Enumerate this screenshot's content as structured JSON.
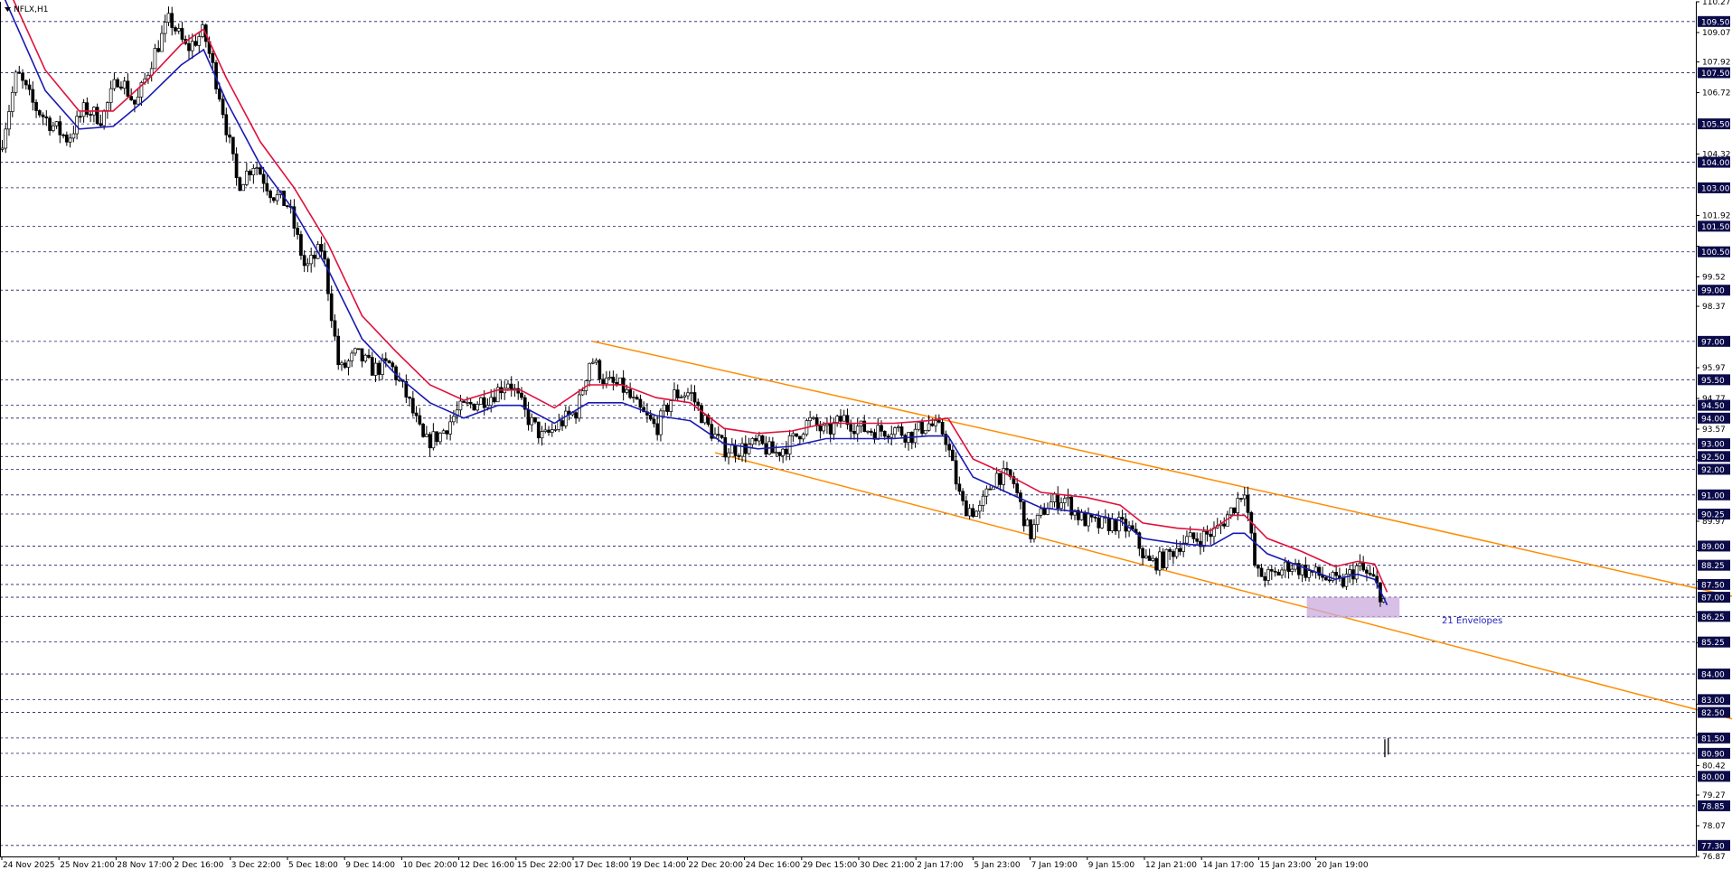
{
  "window": {
    "symbol": "NFLX,H1",
    "menu_icon": "triangle-down-icon"
  },
  "chart_data": {
    "type": "candlestick",
    "symbol": "NFLX",
    "timeframe": "H1",
    "y_range": [
      76.87,
      110.27
    ],
    "x_ticks": [
      "24 Nov 2025",
      "25 Nov 21:00",
      "28 Nov 17:00",
      "2 Dec 16:00",
      "3 Dec 22:00",
      "5 Dec 18:00",
      "9 Dec 14:00",
      "10 Dec 20:00",
      "12 Dec 16:00",
      "15 Dec 22:00",
      "17 Dec 18:00",
      "19 Dec 14:00",
      "22 Dec 20:00",
      "24 Dec 16:00",
      "29 Dec 15:00",
      "30 Dec 21:00",
      "2 Jan 17:00",
      "5 Jan 23:00",
      "7 Jan 19:00",
      "9 Jan 15:00",
      "12 Jan 21:00",
      "14 Jan 17:00",
      "15 Jan 23:00",
      "20 Jan 19:00"
    ],
    "y_ticks": [
      "110.27",
      "109.07",
      "107.92",
      "106.72",
      "104.32",
      "101.92",
      "100.72",
      "99.52",
      "98.37",
      "95.97",
      "94.77",
      "93.57",
      "92.37",
      "89.97",
      "88.82",
      "87.62",
      "86.42",
      "85.22",
      "82.82",
      "81.62",
      "80.42",
      "79.27",
      "78.07",
      "76.87"
    ],
    "price_levels": [
      109.5,
      107.5,
      105.5,
      104.0,
      103.0,
      101.5,
      100.5,
      99.0,
      97.0,
      95.5,
      94.5,
      94.0,
      93.0,
      92.5,
      92.0,
      91.0,
      90.25,
      89.0,
      88.25,
      87.5,
      87.0,
      86.25,
      85.25,
      84.0,
      83.0,
      82.5,
      81.5,
      80.9,
      80.0,
      78.85,
      77.3
    ],
    "price_level_labels": [
      "109.50",
      "107.50",
      "105.50",
      "104.00",
      "103.00",
      "101.50",
      "100.50",
      "99.00",
      "97.00",
      "95.50",
      "94.50",
      "94.00",
      "93.00",
      "92.50",
      "92.00",
      "91.00",
      "90.25",
      "89.00",
      "88.25",
      "87.50",
      "87.00",
      "86.25",
      "85.25",
      "84.00",
      "83.00",
      "82.50",
      "81.50",
      "80.90",
      "80.00",
      "78.85",
      "77.30"
    ],
    "close_path": [
      [
        0,
        104.5
      ],
      [
        15,
        107.5
      ],
      [
        30,
        106.2
      ],
      [
        45,
        105.5
      ],
      [
        60,
        104.9
      ],
      [
        75,
        106.1
      ],
      [
        90,
        105.7
      ],
      [
        105,
        107.4
      ],
      [
        120,
        106.2
      ],
      [
        135,
        108.1
      ],
      [
        150,
        109.6
      ],
      [
        165,
        108.4
      ],
      [
        180,
        109.1
      ],
      [
        195,
        106.5
      ],
      [
        210,
        103.1
      ],
      [
        225,
        104.0
      ],
      [
        240,
        102.8
      ],
      [
        255,
        102.3
      ],
      [
        270,
        99.8
      ],
      [
        285,
        100.7
      ],
      [
        300,
        95.8
      ],
      [
        315,
        96.5
      ],
      [
        330,
        95.9
      ],
      [
        345,
        96.1
      ],
      [
        360,
        94.8
      ],
      [
        375,
        93.0
      ],
      [
        390,
        93.4
      ],
      [
        405,
        94.3
      ],
      [
        420,
        94.6
      ],
      [
        435,
        94.9
      ],
      [
        450,
        95.5
      ],
      [
        465,
        94.1
      ],
      [
        480,
        93.2
      ],
      [
        495,
        93.8
      ],
      [
        510,
        94.3
      ],
      [
        522,
        96.4
      ],
      [
        535,
        95.4
      ],
      [
        550,
        95.2
      ],
      [
        565,
        94.3
      ],
      [
        580,
        93.6
      ],
      [
        595,
        94.9
      ],
      [
        610,
        95.0
      ],
      [
        625,
        93.7
      ],
      [
        640,
        92.8
      ],
      [
        655,
        92.8
      ],
      [
        670,
        93.0
      ],
      [
        685,
        92.6
      ],
      [
        700,
        93.1
      ],
      [
        715,
        93.9
      ],
      [
        730,
        93.4
      ],
      [
        745,
        94.0
      ],
      [
        760,
        93.6
      ],
      [
        775,
        93.5
      ],
      [
        790,
        93.6
      ],
      [
        805,
        93.3
      ],
      [
        820,
        93.8
      ],
      [
        835,
        93.4
      ],
      [
        850,
        90.6
      ],
      [
        865,
        90.3
      ],
      [
        880,
        91.8
      ],
      [
        895,
        91.6
      ],
      [
        910,
        89.4
      ],
      [
        925,
        90.6
      ],
      [
        940,
        90.9
      ],
      [
        955,
        90.1
      ],
      [
        970,
        89.8
      ],
      [
        985,
        89.9
      ],
      [
        1000,
        89.6
      ],
      [
        1015,
        88.3
      ],
      [
        1030,
        88.5
      ],
      [
        1045,
        89.2
      ],
      [
        1060,
        89.3
      ],
      [
        1075,
        89.6
      ],
      [
        1090,
        90.5
      ],
      [
        1100,
        91.3
      ],
      [
        1110,
        87.9
      ],
      [
        1125,
        87.8
      ],
      [
        1140,
        88.3
      ],
      [
        1155,
        88.0
      ],
      [
        1170,
        87.8
      ],
      [
        1185,
        87.5
      ],
      [
        1200,
        88.2
      ],
      [
        1215,
        87.6
      ],
      [
        1224,
        86.8
      ]
    ],
    "envelope_upper": [
      [
        0,
        111.5
      ],
      [
        40,
        107.6
      ],
      [
        70,
        106.0
      ],
      [
        100,
        106.0
      ],
      [
        130,
        107.2
      ],
      [
        160,
        108.6
      ],
      [
        180,
        109.2
      ],
      [
        200,
        107.3
      ],
      [
        230,
        104.8
      ],
      [
        260,
        103.0
      ],
      [
        290,
        100.8
      ],
      [
        320,
        98.0
      ],
      [
        350,
        96.6
      ],
      [
        380,
        95.3
      ],
      [
        410,
        94.7
      ],
      [
        440,
        95.1
      ],
      [
        460,
        95.1
      ],
      [
        490,
        94.4
      ],
      [
        520,
        95.3
      ],
      [
        550,
        95.3
      ],
      [
        580,
        94.8
      ],
      [
        610,
        94.6
      ],
      [
        640,
        93.6
      ],
      [
        670,
        93.4
      ],
      [
        700,
        93.5
      ],
      [
        730,
        93.8
      ],
      [
        760,
        93.8
      ],
      [
        790,
        93.8
      ],
      [
        820,
        93.9
      ],
      [
        838,
        94.0
      ],
      [
        860,
        92.4
      ],
      [
        890,
        91.8
      ],
      [
        920,
        91.1
      ],
      [
        960,
        90.9
      ],
      [
        990,
        90.6
      ],
      [
        1010,
        89.9
      ],
      [
        1040,
        89.7
      ],
      [
        1070,
        89.6
      ],
      [
        1090,
        90.2
      ],
      [
        1100,
        90.2
      ],
      [
        1120,
        89.3
      ],
      [
        1150,
        88.8
      ],
      [
        1180,
        88.2
      ],
      [
        1200,
        88.4
      ],
      [
        1215,
        88.3
      ],
      [
        1226,
        87.2
      ]
    ],
    "envelope_lower": [
      [
        0,
        110.8
      ],
      [
        40,
        106.8
      ],
      [
        70,
        105.3
      ],
      [
        100,
        105.4
      ],
      [
        130,
        106.5
      ],
      [
        160,
        107.8
      ],
      [
        180,
        108.4
      ],
      [
        200,
        106.4
      ],
      [
        230,
        103.9
      ],
      [
        260,
        102.1
      ],
      [
        290,
        99.8
      ],
      [
        320,
        97.1
      ],
      [
        350,
        95.7
      ],
      [
        380,
        94.6
      ],
      [
        410,
        94.0
      ],
      [
        440,
        94.5
      ],
      [
        460,
        94.5
      ],
      [
        490,
        93.8
      ],
      [
        520,
        94.6
      ],
      [
        550,
        94.6
      ],
      [
        580,
        94.1
      ],
      [
        610,
        93.9
      ],
      [
        640,
        93.0
      ],
      [
        670,
        92.8
      ],
      [
        700,
        92.9
      ],
      [
        730,
        93.2
      ],
      [
        760,
        93.2
      ],
      [
        790,
        93.2
      ],
      [
        820,
        93.3
      ],
      [
        838,
        93.3
      ],
      [
        860,
        91.7
      ],
      [
        890,
        91.1
      ],
      [
        920,
        90.5
      ],
      [
        960,
        90.3
      ],
      [
        990,
        90.0
      ],
      [
        1010,
        89.3
      ],
      [
        1040,
        89.1
      ],
      [
        1070,
        89.0
      ],
      [
        1090,
        89.5
      ],
      [
        1100,
        89.5
      ],
      [
        1120,
        88.7
      ],
      [
        1150,
        88.2
      ],
      [
        1180,
        87.7
      ],
      [
        1200,
        87.9
      ],
      [
        1215,
        87.7
      ],
      [
        1226,
        86.7
      ]
    ],
    "trend_channel": {
      "upper": [
        [
          524,
          97.0
        ],
        [
          1535,
          87.0
        ]
      ],
      "lower": [
        [
          632,
          92.65
        ],
        [
          1535,
          82.2
        ]
      ]
    },
    "highlight_zone": {
      "x": [
        1155,
        1237
      ],
      "y": [
        86.2,
        87.0
      ]
    },
    "gap_candles": [
      [
        1224,
        81.45,
        80.75
      ],
      [
        1227,
        81.5,
        80.85
      ]
    ],
    "annotation": "21 Envelopes",
    "colors": {
      "candles": "#000000",
      "envelope_upper": "#e0103c",
      "envelope_lower": "#1a1ab4",
      "trendline": "#ff8c00",
      "level_line": "#1a1a66",
      "level_box": "#0b0b4a",
      "highlight": "#c9a9dd",
      "annotation": "#1f1fbf"
    }
  }
}
